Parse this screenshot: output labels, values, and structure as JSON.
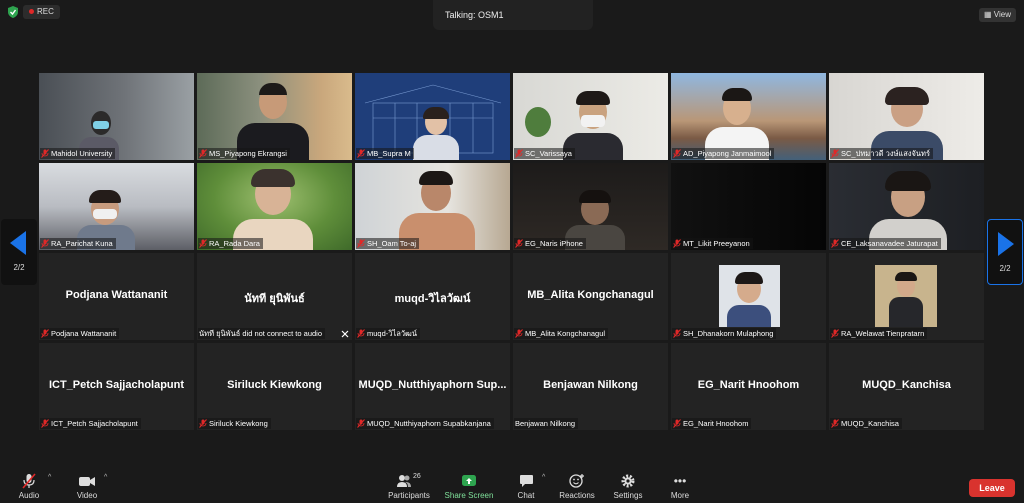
{
  "top": {
    "rec_label": "REC",
    "talking_label": "Talking: OSM1",
    "view_label": "View"
  },
  "pager": {
    "left_label": "2/2",
    "right_label": "2/2"
  },
  "tiles": [
    {
      "name": "Mahidol University"
    },
    {
      "name": "MS_Piyapong Ekrangsi"
    },
    {
      "name": "MB_Supra M"
    },
    {
      "name": "SC_Varissaya"
    },
    {
      "name": "AD_Piyapong Janmaimool"
    },
    {
      "name": "SC_ปทมาวดี วงษ์แสงจันทร์"
    },
    {
      "name": "RA_Parichat Kuna"
    },
    {
      "name": "RA_Rada Dara"
    },
    {
      "name": "SH_Oam To-aj"
    },
    {
      "name": "EG_Naris iPhone"
    },
    {
      "name": "MT_Likit Preeyanon"
    },
    {
      "name": "CE_Laksanavadee Jaturapat"
    },
    {
      "center": "Podjana Wattananit",
      "name": "Podjana Wattananit"
    },
    {
      "center": "นัทที ยุนิพันธ์",
      "name": "นัทที ยุนิพันธ์ did not connect to audio"
    },
    {
      "center": "muqd-วิไลวัฒน์",
      "name": "muqd-วิไลวัฒน์"
    },
    {
      "center": "MB_Alita Kongchanagul",
      "name": "MB_Alita Kongchanagul"
    },
    {
      "name": "SH_Dhanakorn Mulaphong"
    },
    {
      "name": "RA_Welawat Tienpratarn"
    },
    {
      "center": "ICT_Petch Sajjacholapunt",
      "name": "ICT_Petch Sajjacholapunt"
    },
    {
      "center": "Siriluck Kiewkong",
      "name": "Siriluck Kiewkong"
    },
    {
      "center": "MUQD_Nutthiyaphorn Sup...",
      "name": "MUQD_Nutthiyaphorn Supabkanjana"
    },
    {
      "center": "Benjawan Nilkong",
      "name": "Benjawan Nilkong"
    },
    {
      "center": "EG_Narit Hnoohom",
      "name": "EG_Narit Hnoohom"
    },
    {
      "center": "MUQD_Kanchisa",
      "name": "MUQD_Kanchisa"
    }
  ],
  "toolbar": {
    "audio_label": "Audio",
    "video_label": "Video",
    "participants_label": "Participants",
    "participants_count": "26",
    "share_label": "Share Screen",
    "chat_label": "Chat",
    "reactions_label": "Reactions",
    "settings_label": "Settings",
    "more_label": "More",
    "leave_label": "Leave"
  },
  "colors": {
    "accent": "#1a73e8",
    "share_green": "#2ea44f",
    "leave_red": "#d9332e",
    "mute_red": "#e02828"
  }
}
